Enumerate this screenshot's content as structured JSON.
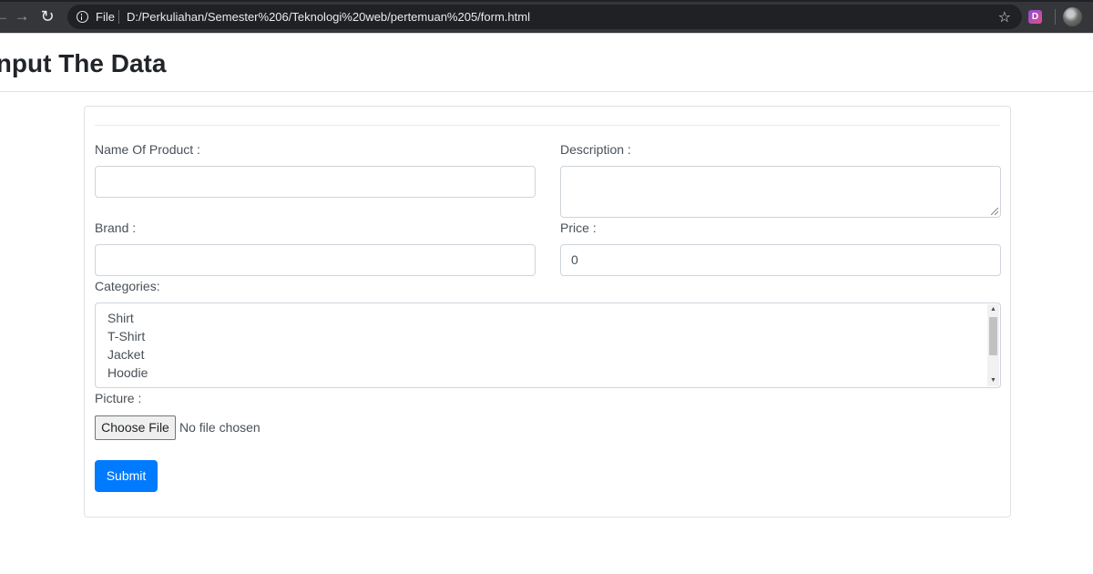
{
  "browser": {
    "nav": {
      "back_icon": "arrow-left-icon",
      "forward_icon": "arrow-right-icon",
      "reload_icon": "reload-icon"
    },
    "address_bar": {
      "scheme_label": "File",
      "url": "D:/Perkuliahan/Semester%206/Teknologi%20web/pertemuan%205/form.html",
      "info_icon": "info-icon",
      "bookmark_icon": "star-icon"
    },
    "extension_badge": "D",
    "colors": {
      "chrome_bg": "#35363a",
      "omnibox_bg": "#202124"
    }
  },
  "page": {
    "title": "Input The Data"
  },
  "form": {
    "name_label": "Name Of Product :",
    "name_value": "",
    "description_label": "Description :",
    "description_value": "",
    "brand_label": "Brand :",
    "brand_value": "",
    "price_label": "Price :",
    "price_value": "0",
    "categories_label": "Categories:",
    "categories_options": [
      "Shirt",
      "T-Shirt",
      "Jacket",
      "Hoodie"
    ],
    "picture_label": "Picture :",
    "file_button_label": "Choose File",
    "file_status": "No file chosen",
    "submit_label": "Submit",
    "colors": {
      "primary": "#007bff",
      "label_text": "#495057"
    }
  }
}
